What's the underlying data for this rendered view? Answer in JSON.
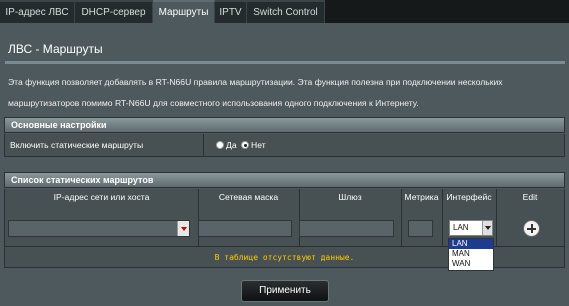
{
  "tabs": [
    {
      "label": "IP-адрес ЛВС"
    },
    {
      "label": "DHCP-сервер"
    },
    {
      "label": "Маршруты"
    },
    {
      "label": "IPTV"
    },
    {
      "label": "Switch Control"
    }
  ],
  "page": {
    "title": "ЛВС - Маршруты",
    "description": "Эта функция позволяет добавлять в RT-N66U правила маршрутизации. Эта функция полезна при подключении нескольких маршрутизаторов помимо RT-N66U для совместного использования одного подключения к Интернету."
  },
  "basic": {
    "header": "Основные настройки",
    "static_routes_label": "Включить статические маршруты",
    "option_yes": "Да",
    "option_no": "Нет",
    "selected": "Нет"
  },
  "routes": {
    "header": "Список статических маршрутов",
    "columns": [
      "IP-адрес сети или хоста",
      "Сетевая маска",
      "Шлюз",
      "Метрика",
      "Интерфейс",
      "Edit"
    ],
    "interface_value": "LAN",
    "interface_options": [
      "LAN",
      "MAN",
      "WAN"
    ],
    "empty_message": "В таблице отсутствуют данные."
  },
  "apply_label": "Применить",
  "colors": {
    "background": "#4d595d",
    "empty_message": "#ffcc00",
    "dropdown_selected": "#1d3b8f"
  }
}
